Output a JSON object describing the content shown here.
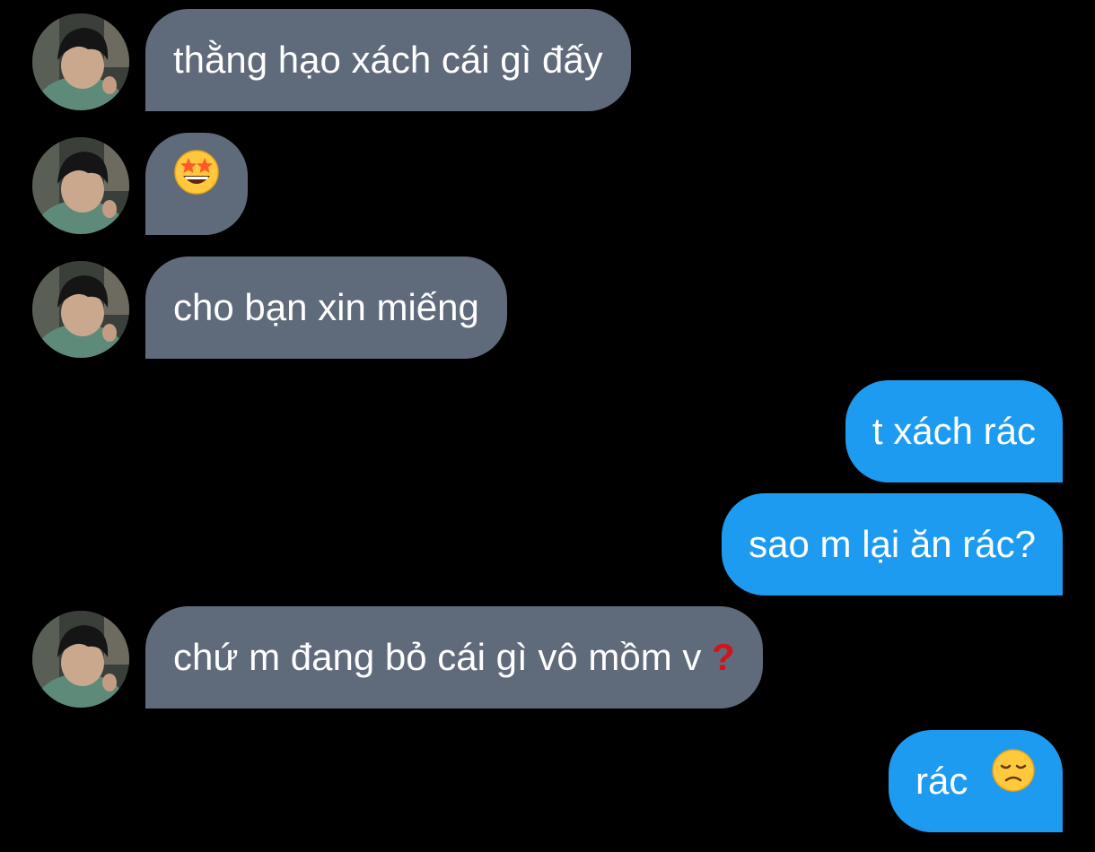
{
  "colors": {
    "background": "#000000",
    "incoming_bubble": "#5f6b7a",
    "outgoing_bubble": "#1d9bf0",
    "text": "#ffffff",
    "question_mark": "#d0141a"
  },
  "messages": [
    {
      "direction": "incoming",
      "text": "thằng hạo xách cái gì đấy",
      "has_avatar": true
    },
    {
      "direction": "incoming",
      "text": "",
      "emoji": "star-struck-emoji",
      "has_avatar": true
    },
    {
      "direction": "incoming",
      "text": "cho bạn xin miếng",
      "has_avatar": true
    },
    {
      "direction": "outgoing",
      "text": "t xách rác"
    },
    {
      "direction": "outgoing",
      "text": "sao m lại ăn rác?"
    },
    {
      "direction": "incoming",
      "text": "chứ m đang bỏ cái gì vô mồm v",
      "emoji": "red-question-mark-emoji",
      "emoji_char": "?",
      "has_avatar": true
    },
    {
      "direction": "outgoing",
      "text": "rác",
      "emoji": "disappointed-face-emoji"
    }
  ]
}
